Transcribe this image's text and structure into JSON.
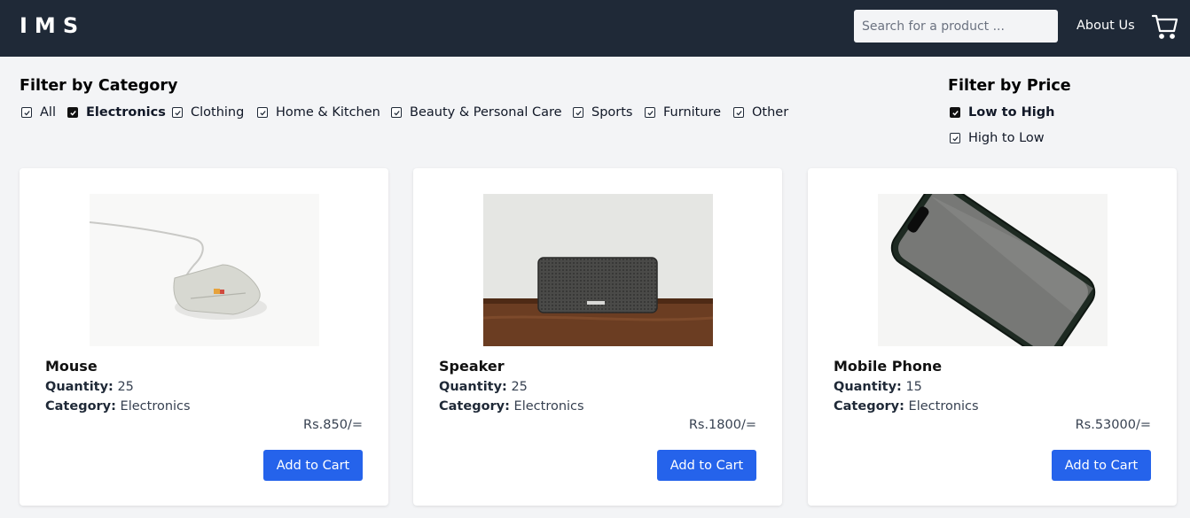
{
  "header": {
    "logo": "IMS",
    "search_placeholder": "Search for a product ...",
    "about_label": "About Us",
    "cart_icon": "shopping-cart-icon"
  },
  "category_filter": {
    "title": "Filter by Category",
    "options": [
      {
        "label": "All",
        "checked": false
      },
      {
        "label": "Electronics",
        "checked": true
      },
      {
        "label": "Clothing",
        "checked": false
      },
      {
        "label": "Home & Kitchen",
        "checked": false
      },
      {
        "label": "Beauty & Personal Care",
        "checked": false
      },
      {
        "label": "Sports",
        "checked": false
      },
      {
        "label": "Furniture",
        "checked": false
      },
      {
        "label": "Other",
        "checked": false
      }
    ]
  },
  "price_filter": {
    "title": "Filter by Price",
    "options": [
      {
        "label": "Low to High",
        "checked": true
      },
      {
        "label": "High to Low",
        "checked": false
      }
    ]
  },
  "labels": {
    "quantity": "Quantity:",
    "category": "Category:",
    "add_to_cart": "Add to Cart"
  },
  "products": [
    {
      "name": "Mouse",
      "quantity": "25",
      "category": "Electronics",
      "price": "Rs.850/="
    },
    {
      "name": "Speaker",
      "quantity": "25",
      "category": "Electronics",
      "price": "Rs.1800/="
    },
    {
      "name": "Mobile Phone",
      "quantity": "15",
      "category": "Electronics",
      "price": "Rs.53000/="
    }
  ],
  "colors": {
    "navbar": "#1f2937",
    "background": "#f3f4f6",
    "button": "#2563eb"
  }
}
